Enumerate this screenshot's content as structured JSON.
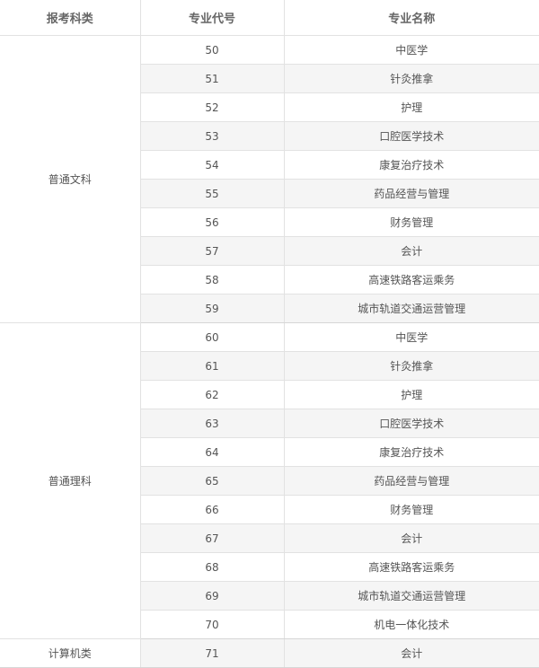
{
  "table": {
    "headers": [
      "报考科类",
      "专业代号",
      "专业名称"
    ],
    "groups": [
      {
        "category": "普通文科",
        "rows": [
          {
            "code": "50",
            "name": "中医学"
          },
          {
            "code": "51",
            "name": "针灸推拿"
          },
          {
            "code": "52",
            "name": "护理"
          },
          {
            "code": "53",
            "name": "口腔医学技术"
          },
          {
            "code": "54",
            "name": "康复治疗技术"
          },
          {
            "code": "55",
            "name": "药品经营与管理"
          },
          {
            "code": "56",
            "name": "财务管理"
          },
          {
            "code": "57",
            "name": "会计"
          },
          {
            "code": "58",
            "name": "高速铁路客运乘务"
          },
          {
            "code": "59",
            "name": "城市轨道交通运营管理"
          }
        ]
      },
      {
        "category": "普通理科",
        "rows": [
          {
            "code": "60",
            "name": "中医学"
          },
          {
            "code": "61",
            "name": "针灸推拿"
          },
          {
            "code": "62",
            "name": "护理"
          },
          {
            "code": "63",
            "name": "口腔医学技术"
          },
          {
            "code": "64",
            "name": "康复治疗技术"
          },
          {
            "code": "65",
            "name": "药品经营与管理"
          },
          {
            "code": "66",
            "name": "财务管理"
          },
          {
            "code": "67",
            "name": "会计"
          },
          {
            "code": "68",
            "name": "高速铁路客运乘务"
          },
          {
            "code": "69",
            "name": "城市轨道交通运营管理"
          },
          {
            "code": "70",
            "name": "机电一体化技术"
          }
        ]
      },
      {
        "category": "计算机类",
        "rows": [
          {
            "code": "71",
            "name": "会计"
          }
        ]
      }
    ]
  }
}
